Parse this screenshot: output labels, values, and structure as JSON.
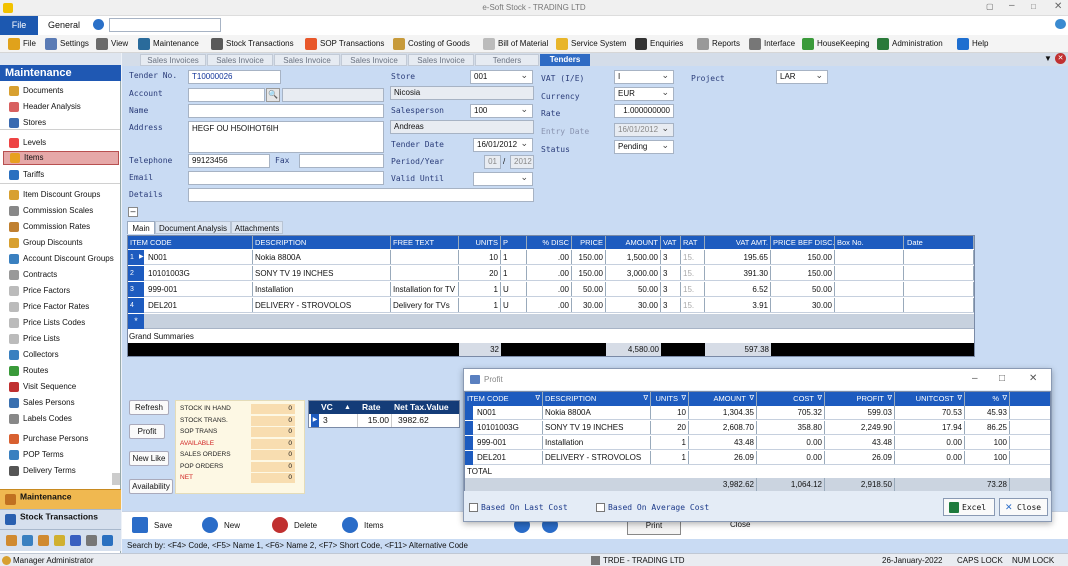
{
  "window": {
    "title": "e-Soft Stock - TRADING LTD"
  },
  "menu": {
    "file": "File",
    "general": "General"
  },
  "toolbar": [
    {
      "label": "File",
      "icon": "folder-icon",
      "color": "#e0a21b"
    },
    {
      "label": "Settings",
      "icon": "gears-icon",
      "color": "#5a7bb5"
    },
    {
      "label": "View",
      "icon": "view-icon",
      "color": "#6b6b6b"
    },
    {
      "label": "Maintenance",
      "icon": "monitor-icon",
      "color": "#2a6b9b"
    },
    {
      "label": "Stock Transactions",
      "icon": "stock-icon",
      "color": "#5a5a5a"
    },
    {
      "label": "SOP Transactions",
      "icon": "sop-icon",
      "color": "#e8572a"
    },
    {
      "label": "Costing of Goods",
      "icon": "costing-icon",
      "color": "#c79a3a"
    },
    {
      "label": "Bill of Material",
      "icon": "bill-icon",
      "color": "#bbb"
    },
    {
      "label": "Service System",
      "icon": "wrench-icon",
      "color": "#e8b52a"
    },
    {
      "label": "Enquiries",
      "icon": "enquiries-icon",
      "color": "#333"
    },
    {
      "label": "Reports",
      "icon": "reports-icon",
      "color": "#999"
    },
    {
      "label": "Interface",
      "icon": "interface-icon",
      "color": "#777"
    },
    {
      "label": "HouseKeeping",
      "icon": "housekeeping-icon",
      "color": "#3a9a3a"
    },
    {
      "label": "Administration",
      "icon": "admin-icon",
      "color": "#2a7a3a"
    },
    {
      "label": "Help",
      "icon": "help-icon",
      "color": "#1e6fd0"
    }
  ],
  "sidebar": {
    "title": "Maintenance",
    "items": [
      {
        "label": "Documents",
        "icon": "documents-icon",
        "color": "#d8a030"
      },
      {
        "label": "Header Analysis",
        "icon": "header-analysis-icon",
        "color": "#d86060"
      },
      {
        "label": "Stores",
        "icon": "stores-icon",
        "color": "#3a6ab0"
      },
      {
        "label": "Levels",
        "icon": "levels-icon",
        "color": "#e44"
      },
      {
        "label": "Items",
        "icon": "items-icon",
        "color": "#e8a020"
      },
      {
        "label": "Tariffs",
        "icon": "tariffs-icon",
        "color": "#2a70c0"
      },
      {
        "label": "Item Discount Groups",
        "icon": "discount-icon",
        "color": "#d8a030"
      },
      {
        "label": "Commission Scales",
        "icon": "commission-icon",
        "color": "#888"
      },
      {
        "label": "Commission Rates",
        "icon": "rates-icon",
        "color": "#c08030"
      },
      {
        "label": "Group Discounts",
        "icon": "group-icon",
        "color": "#d8a030"
      },
      {
        "label": "Account Discount Groups",
        "icon": "account-icon",
        "color": "#3a80c0"
      },
      {
        "label": "Contracts",
        "icon": "contracts-icon",
        "color": "#999"
      },
      {
        "label": "Price Factors",
        "icon": "price-factors-icon",
        "color": "#bbb"
      },
      {
        "label": "Price Factor Rates",
        "icon": "factor-rates-icon",
        "color": "#bbb"
      },
      {
        "label": "Price Lists Codes",
        "icon": "price-codes-icon",
        "color": "#bbb"
      },
      {
        "label": "Price Lists",
        "icon": "price-lists-icon",
        "color": "#bbb"
      },
      {
        "label": "Collectors",
        "icon": "collectors-icon",
        "color": "#3a80c0"
      },
      {
        "label": "Routes",
        "icon": "routes-icon",
        "color": "#3a9a3a"
      },
      {
        "label": "Visit Sequence",
        "icon": "visit-icon",
        "color": "#c03030"
      },
      {
        "label": "Sales Persons",
        "icon": "sales-persons-icon",
        "color": "#3a70b0"
      },
      {
        "label": "Labels Codes",
        "icon": "labels-icon",
        "color": "#888"
      },
      {
        "label": "Purchase Persons",
        "icon": "purchase-icon",
        "color": "#d86030"
      },
      {
        "label": "POP Terms",
        "icon": "pop-icon",
        "color": "#3a80c0"
      },
      {
        "label": "Delivery Terms",
        "icon": "delivery-icon",
        "color": "#555"
      }
    ],
    "bottom1": "Maintenance",
    "bottom2": "Stock Transactions"
  },
  "tabs": [
    "Sales Invoices",
    "Sales Invoice",
    "Sales Invoice",
    "Sales Invoice",
    "Sales Invoice",
    "Tenders",
    "Tenders"
  ],
  "form": {
    "tender_no_label": "Tender No.",
    "tender_no": "T10000026",
    "account_label": "Account",
    "name_label": "Name",
    "address_label": "Address",
    "address": "HEGF OU H5OIHOT6IH",
    "telephone_label": "Telephone",
    "telephone": "99123456",
    "fax_label": "Fax",
    "email_label": "Email",
    "details_label": "Details",
    "store_label": "Store",
    "store": "001",
    "store_name": "Nicosia",
    "salesperson_label": "Salesperson",
    "salesperson": "100",
    "salesperson_name": "Andreas",
    "tender_date_label": "Tender Date",
    "tender_date": "16/01/2012",
    "period_label": "Period/Year",
    "period": "01",
    "year": "2012",
    "valid_label": "Valid Until",
    "vat_label": "VAT (I/E)",
    "vat": "I",
    "currency_label": "Currency",
    "currency": "EUR",
    "rate_label": "Rate",
    "rate": "1.000000000",
    "entry_date_label": "Entry Date",
    "entry_date": "16/01/2012",
    "status_label": "Status",
    "status": "Pending",
    "project_label": "Project",
    "project": "LAR"
  },
  "subtabs": [
    "Main",
    "Document Analysis",
    "Attachments"
  ],
  "grid": {
    "headers": [
      "ITEM CODE",
      "DESCRIPTION",
      "FREE TEXT",
      "UNITS",
      "P",
      "% DISC",
      "PRICE",
      "AMOUNT",
      "VAT",
      "RAT",
      "VAT AMT.",
      "PRICE BEF DISC.",
      "Box No.",
      "Date"
    ],
    "rows": [
      {
        "n": "1",
        "code": "N001",
        "desc": "Nokia 8800A",
        "free": "",
        "units": "10",
        "p": "1",
        "disc": ".00",
        "price": "150.00",
        "amount": "1,500.00",
        "vat": "3",
        "rat": "15.",
        "vatamt": "195.65",
        "pbd": "150.00"
      },
      {
        "n": "2",
        "code": "10101003G",
        "desc": "SONY TV 19 INCHES",
        "free": "",
        "units": "20",
        "p": "1",
        "disc": ".00",
        "price": "150.00",
        "amount": "3,000.00",
        "vat": "3",
        "rat": "15.",
        "vatamt": "391.30",
        "pbd": "150.00"
      },
      {
        "n": "3",
        "code": "999-001",
        "desc": "Installation",
        "free": "Installation for TV",
        "units": "1",
        "p": "U",
        "disc": ".00",
        "price": "50.00",
        "amount": "50.00",
        "vat": "3",
        "rat": "15.",
        "vatamt": "6.52",
        "pbd": "50.00"
      },
      {
        "n": "4",
        "code": "DEL201",
        "desc": "DELIVERY - STROVOLOS",
        "free": "Delivery for TVs",
        "units": "1",
        "p": "U",
        "disc": ".00",
        "price": "30.00",
        "amount": "30.00",
        "vat": "3",
        "rat": "15.",
        "vatamt": "3.91",
        "pbd": "30.00"
      }
    ],
    "new_row": "*",
    "summary_label": "Grand Summaries",
    "total_units": "32",
    "total_amount": "4,580.00",
    "total_vat": "597.38"
  },
  "side_buttons": [
    "Refresh",
    "Profit",
    "New Like",
    "Availability"
  ],
  "stock_info": [
    {
      "label": "STOCK IN HAND",
      "value": "0",
      "color": "#222"
    },
    {
      "label": "STOCK TRANS.",
      "value": "0",
      "color": "#222"
    },
    {
      "label": "SOP TRANS",
      "value": "0",
      "color": "#222"
    },
    {
      "label": "AVAILABLE",
      "value": "0",
      "color": "#d02020"
    },
    {
      "label": "SALES ORDERS",
      "value": "0",
      "color": "#222"
    },
    {
      "label": "POP ORDERS",
      "value": "0",
      "color": "#222"
    },
    {
      "label": "NET",
      "value": "0",
      "color": "#d02020"
    }
  ],
  "vc_grid": {
    "headers": [
      "VC",
      "Rate",
      "Net Tax.Value"
    ],
    "row": {
      "vc": "3",
      "rate": "15.00",
      "net": "3982.62"
    }
  },
  "actions": [
    "Save",
    "New",
    "Delete",
    "Items"
  ],
  "hidden_actions": [
    "Print",
    "Close"
  ],
  "hint": "Search by:  <F4> Code, <F5> Name 1, <F6> Name 2, <F7> Short Code, <F11> Alternative Code",
  "status_bar": {
    "user": "Manager Administrator",
    "company": "TRDE - TRADING LTD",
    "date": "26-January-2022",
    "caps": "CAPS LOCK",
    "num": "NUM LOCK"
  },
  "profit": {
    "title": "Profit",
    "headers": [
      "ITEM CODE",
      "DESCRIPTION",
      "UNITS",
      "AMOUNT",
      "COST",
      "PROFIT",
      "UNITCOST",
      "%"
    ],
    "rows": [
      {
        "code": "N001",
        "desc": "Nokia 8800A",
        "units": "10",
        "amount": "1,304.35",
        "cost": "705.32",
        "profit": "599.03",
        "unitcost": "70.53",
        "pct": "45.93"
      },
      {
        "code": "10101003G",
        "desc": "SONY TV 19 INCHES",
        "units": "20",
        "amount": "2,608.70",
        "cost": "358.80",
        "profit": "2,249.90",
        "unitcost": "17.94",
        "pct": "86.25"
      },
      {
        "code": "999-001",
        "desc": "Installation",
        "units": "1",
        "amount": "43.48",
        "cost": "0.00",
        "profit": "43.48",
        "unitcost": "0.00",
        "pct": "100"
      },
      {
        "code": "DEL201",
        "desc": "DELIVERY - STROVOLOS",
        "units": "1",
        "amount": "26.09",
        "cost": "0.00",
        "profit": "26.09",
        "unitcost": "0.00",
        "pct": "100"
      }
    ],
    "total_label": "TOTAL",
    "totals": {
      "amount": "3,982.62",
      "cost": "1,064.12",
      "profit": "2,918.50",
      "pct": "73.28"
    },
    "cb_last": "Based On Last Cost",
    "cb_avg": "Based On Average Cost",
    "excel": "Excel",
    "close": "Close"
  }
}
